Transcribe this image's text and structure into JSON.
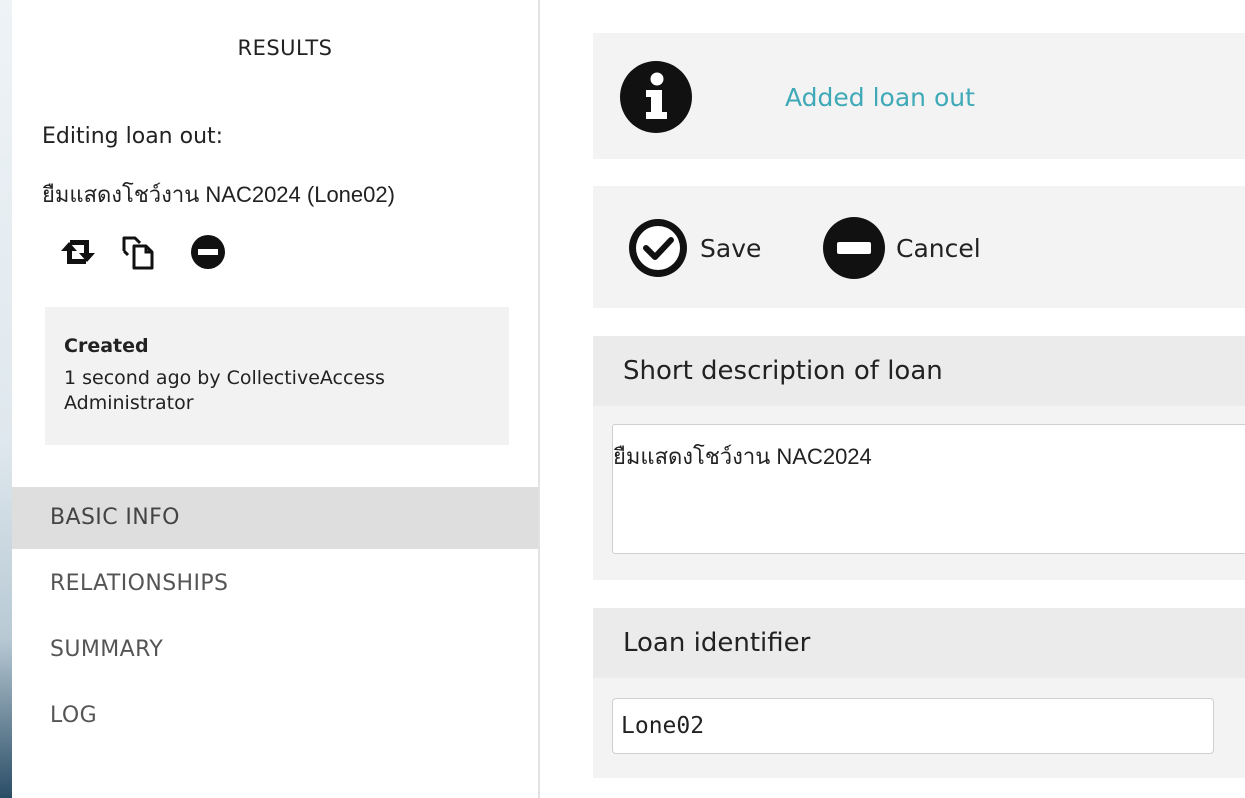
{
  "sidebar": {
    "results_label": "RESULTS",
    "editing_label": "Editing loan out:",
    "record_title": "ยืมแสดงโชว์งาน NAC2024 (Lone02)",
    "icons": [
      "swap-icon",
      "duplicate-icon",
      "delete-icon"
    ],
    "created": {
      "title": "Created",
      "text": "1 second ago by CollectiveAccess Administrator"
    },
    "nav": [
      {
        "label": "BASIC INFO",
        "active": true
      },
      {
        "label": "RELATIONSHIPS",
        "active": false
      },
      {
        "label": "SUMMARY",
        "active": false
      },
      {
        "label": "LOG",
        "active": false
      }
    ]
  },
  "notice": {
    "icon": "info-icon",
    "text": "Added loan out",
    "color": "#3fa9b8"
  },
  "actions": {
    "save_label": "Save",
    "cancel_label": "Cancel"
  },
  "fields": {
    "short_description": {
      "label": "Short description of loan",
      "value": "ยืมแสดงโชว์งาน NAC2024"
    },
    "loan_identifier": {
      "label": "Loan identifier",
      "value": "Lone02"
    }
  }
}
